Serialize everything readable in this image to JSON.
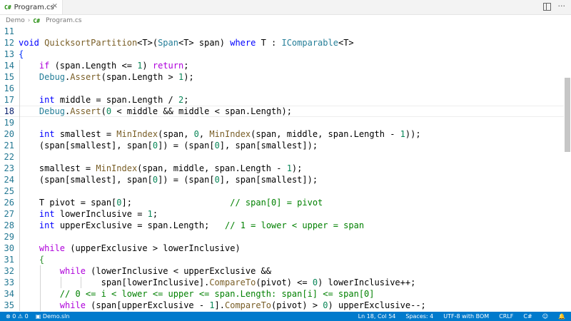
{
  "tabs": [
    {
      "label": "Program.cs",
      "icon": "csharp-file-icon"
    }
  ],
  "breadcrumbs": [
    "Demo",
    "Program.cs"
  ],
  "editor": {
    "current_line": "18",
    "lines": [
      {
        "n": "11",
        "segs": []
      },
      {
        "n": "12",
        "segs": [
          [
            "void ",
            "#0000ff"
          ],
          [
            "QuicksortPartition",
            "#795e26"
          ],
          [
            "<T>(",
            ""
          ],
          [
            "Span",
            "#267f99"
          ],
          [
            "<T> span) ",
            ""
          ],
          [
            "where",
            "#0000ff"
          ],
          [
            " T : ",
            ""
          ],
          [
            "IComparable",
            "#267f99"
          ],
          [
            "<T>",
            ""
          ]
        ]
      },
      {
        "n": "13",
        "segs": [
          [
            "{",
            "#0431fa"
          ]
        ]
      },
      {
        "n": "14",
        "segs": [
          [
            "    ",
            ""
          ],
          [
            "if",
            "#af00db"
          ],
          [
            " (span.Length <= ",
            ""
          ],
          [
            "1",
            "#098658"
          ],
          [
            ") ",
            ""
          ],
          [
            "return",
            "#af00db"
          ],
          [
            ";",
            ""
          ]
        ]
      },
      {
        "n": "15",
        "segs": [
          [
            "    ",
            ""
          ],
          [
            "Debug",
            "#267f99"
          ],
          [
            ".",
            ""
          ],
          [
            "Assert",
            "#795e26"
          ],
          [
            "(span.Length > ",
            ""
          ],
          [
            "1",
            "#098658"
          ],
          [
            ");",
            ""
          ]
        ]
      },
      {
        "n": "16",
        "segs": []
      },
      {
        "n": "17",
        "segs": [
          [
            "    ",
            ""
          ],
          [
            "int",
            "#0000ff"
          ],
          [
            " middle = span.Length / ",
            ""
          ],
          [
            "2",
            "#098658"
          ],
          [
            ";",
            ""
          ]
        ]
      },
      {
        "n": "18",
        "segs": [
          [
            "    ",
            ""
          ],
          [
            "Debug",
            "#267f99"
          ],
          [
            ".",
            ""
          ],
          [
            "Assert",
            "#795e26"
          ],
          [
            "(",
            ""
          ],
          [
            "0",
            "#098658"
          ],
          [
            " < middle && middle < span.Length);",
            ""
          ]
        ]
      },
      {
        "n": "19",
        "segs": []
      },
      {
        "n": "20",
        "segs": [
          [
            "    ",
            ""
          ],
          [
            "int",
            "#0000ff"
          ],
          [
            " smallest = ",
            ""
          ],
          [
            "MinIndex",
            "#795e26"
          ],
          [
            "(span, ",
            ""
          ],
          [
            "0",
            "#098658"
          ],
          [
            ", ",
            ""
          ],
          [
            "MinIndex",
            "#795e26"
          ],
          [
            "(span, middle, span.Length - ",
            ""
          ],
          [
            "1",
            "#098658"
          ],
          [
            "));",
            ""
          ]
        ]
      },
      {
        "n": "21",
        "segs": [
          [
            "    (span[smallest], span[",
            ""
          ],
          [
            "0",
            "#098658"
          ],
          [
            "]) = (span[",
            ""
          ],
          [
            "0",
            "#098658"
          ],
          [
            "], span[smallest]);",
            ""
          ]
        ]
      },
      {
        "n": "22",
        "segs": []
      },
      {
        "n": "23",
        "segs": [
          [
            "    smallest = ",
            ""
          ],
          [
            "MinIndex",
            "#795e26"
          ],
          [
            "(span, middle, span.Length - ",
            ""
          ],
          [
            "1",
            "#098658"
          ],
          [
            ");",
            ""
          ]
        ]
      },
      {
        "n": "24",
        "segs": [
          [
            "    (span[smallest], span[",
            ""
          ],
          [
            "0",
            "#098658"
          ],
          [
            "]) = (span[",
            ""
          ],
          [
            "0",
            "#098658"
          ],
          [
            "], span[smallest]);",
            ""
          ]
        ]
      },
      {
        "n": "25",
        "segs": []
      },
      {
        "n": "26",
        "segs": [
          [
            "    T pivot = span[",
            ""
          ],
          [
            "0",
            "#098658"
          ],
          [
            "];                   ",
            ""
          ],
          [
            "// span[0] = pivot",
            "#008000"
          ]
        ]
      },
      {
        "n": "27",
        "segs": [
          [
            "    ",
            ""
          ],
          [
            "int",
            "#0000ff"
          ],
          [
            " lowerInclusive = ",
            ""
          ],
          [
            "1",
            "#098658"
          ],
          [
            ";",
            ""
          ]
        ]
      },
      {
        "n": "28",
        "segs": [
          [
            "    ",
            ""
          ],
          [
            "int",
            "#0000ff"
          ],
          [
            " upperExclusive = span.Length;   ",
            ""
          ],
          [
            "// 1 = lower < upper = span",
            "#008000"
          ]
        ]
      },
      {
        "n": "29",
        "segs": []
      },
      {
        "n": "30",
        "segs": [
          [
            "    ",
            ""
          ],
          [
            "while",
            "#af00db"
          ],
          [
            " (upperExclusive > lowerInclusive)",
            ""
          ]
        ]
      },
      {
        "n": "31",
        "segs": [
          [
            "    ",
            ""
          ],
          [
            "{",
            "#319331"
          ]
        ]
      },
      {
        "n": "32",
        "segs": [
          [
            "        ",
            ""
          ],
          [
            "while",
            "#af00db"
          ],
          [
            " (lowerInclusive < upperExclusive &&",
            ""
          ]
        ]
      },
      {
        "n": "33",
        "segs": [
          [
            "                span[lowerInclusive].",
            ""
          ],
          [
            "CompareTo",
            "#795e26"
          ],
          [
            "(pivot) <= ",
            ""
          ],
          [
            "0",
            "#098658"
          ],
          [
            ") lowerInclusive++;",
            ""
          ]
        ]
      },
      {
        "n": "34",
        "segs": [
          [
            "        ",
            ""
          ],
          [
            "// 0 <= i < lower <= upper <= span.Length: span[i] <= span[0]",
            "#008000"
          ]
        ]
      },
      {
        "n": "35",
        "segs": [
          [
            "        ",
            ""
          ],
          [
            "while",
            "#af00db"
          ],
          [
            " (span[upperExclusive - ",
            ""
          ],
          [
            "1",
            "#098658"
          ],
          [
            "].",
            ""
          ],
          [
            "CompareTo",
            "#795e26"
          ],
          [
            "(pivot) > ",
            ""
          ],
          [
            "0",
            "#098658"
          ],
          [
            ") upperExclusive--;",
            ""
          ]
        ]
      }
    ]
  },
  "status": {
    "errors": "0",
    "warnings": "0",
    "solution": "Demo.sln",
    "position": "Ln 18, Col 54",
    "spaces": "Spaces: 4",
    "encoding": "UTF-8 with BOM",
    "eol": "CRLF",
    "language": "C#"
  },
  "colors": {
    "accent": "#007acc",
    "line_number": "#237893"
  }
}
